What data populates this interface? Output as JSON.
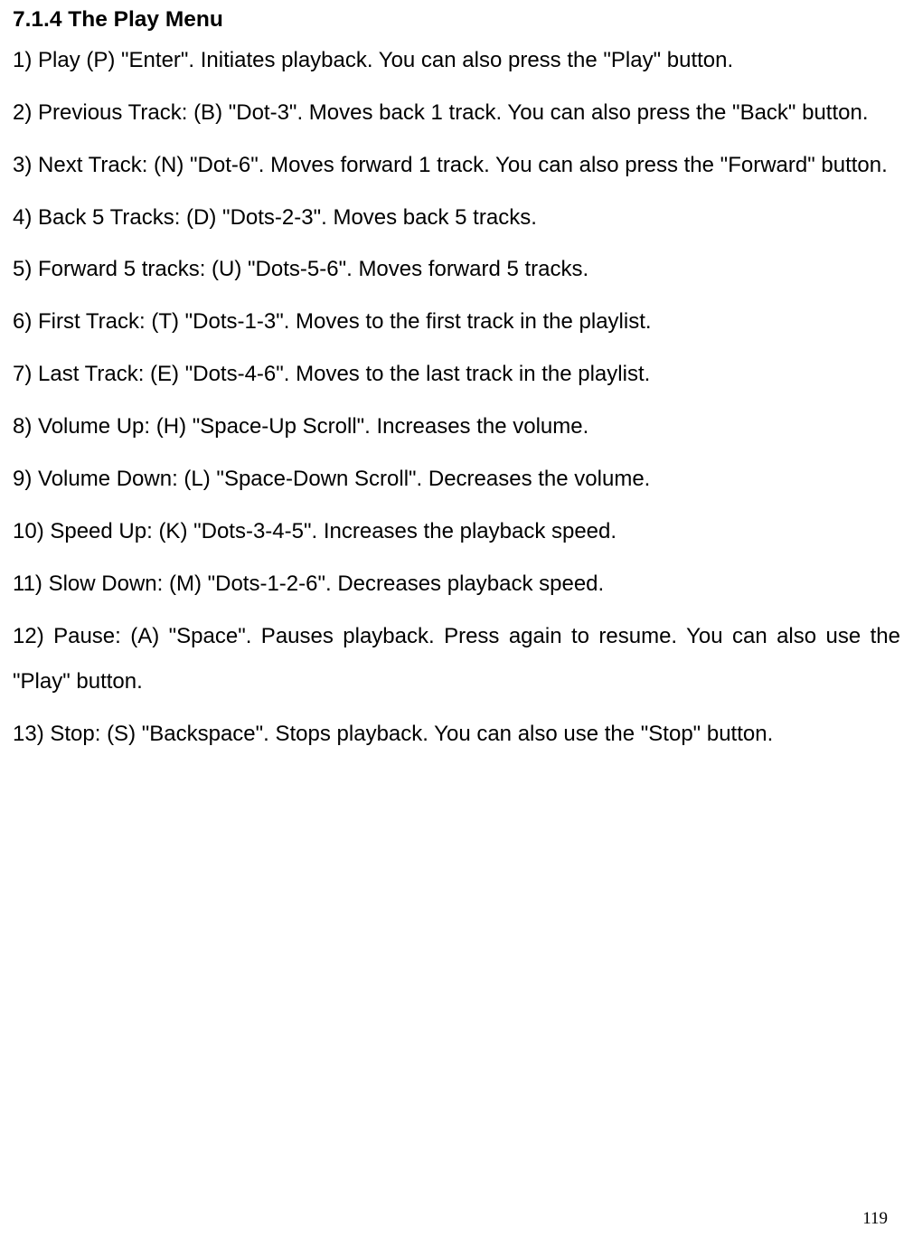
{
  "heading": "7.1.4 The Play Menu",
  "items": [
    "1) Play (P) \"Enter\". Initiates playback. You can also press the \"Play\" button.",
    "2) Previous Track: (B) \"Dot-3\". Moves back 1 track. You can also press the \"Back\" button.",
    "3) Next Track: (N) \"Dot-6\". Moves forward 1 track. You can also press the \"Forward\" button.",
    "4) Back 5 Tracks: (D) \"Dots-2-3\". Moves back 5 tracks.",
    "5) Forward 5 tracks: (U) \"Dots-5-6\". Moves forward 5 tracks.",
    "6) First Track: (T) \"Dots-1-3\". Moves to the first track in the playlist.",
    "7) Last Track: (E) \"Dots-4-6\". Moves to the last track in the playlist.",
    "8) Volume Up: (H) \"Space-Up Scroll\". Increases the volume.",
    "9) Volume Down: (L) \"Space-Down Scroll\". Decreases the volume.",
    "10) Speed Up: (K) \"Dots-3-4-5\". Increases the playback speed.",
    "11) Slow Down: (M) \"Dots-1-2-6\". Decreases playback speed.",
    "12) Pause: (A) \"Space\". Pauses playback. Press again to resume. You can also use the \"Play\" button.",
    "13) Stop: (S) \"Backspace\". Stops playback. You can also use the \"Stop\" button."
  ],
  "pageNumber": "119"
}
